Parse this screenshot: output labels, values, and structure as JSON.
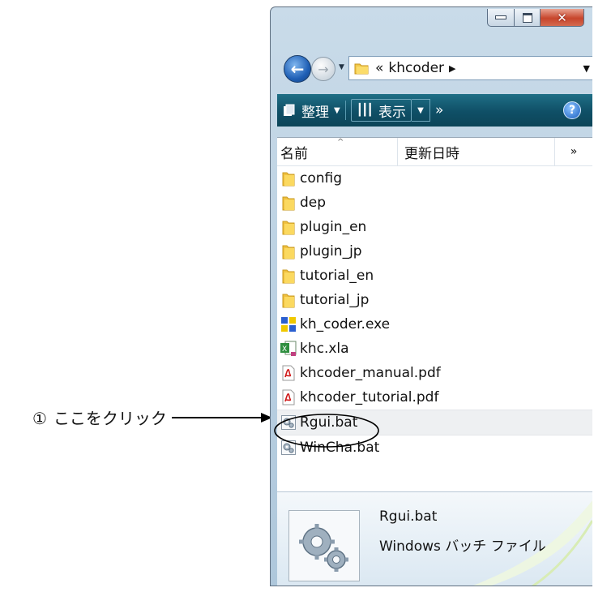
{
  "annotation": {
    "number": "①",
    "text": "ここをクリック"
  },
  "window": {
    "caption_buttons": {
      "minimize": "minimize-icon",
      "maximize": "maximize-icon",
      "close": "close-icon"
    },
    "address": {
      "prefix": "«",
      "path": "khcoder"
    },
    "toolbar": {
      "organize": "整理",
      "views": "表示",
      "more": "»",
      "help": "?"
    },
    "columns": {
      "name": "名前",
      "date_modified": "更新日時",
      "more": "»"
    },
    "files": [
      {
        "name": "config",
        "icon": "folder-icon"
      },
      {
        "name": "dep",
        "icon": "folder-icon"
      },
      {
        "name": "plugin_en",
        "icon": "folder-icon"
      },
      {
        "name": "plugin_jp",
        "icon": "folder-icon"
      },
      {
        "name": "tutorial_en",
        "icon": "folder-icon"
      },
      {
        "name": "tutorial_jp",
        "icon": "folder-icon"
      },
      {
        "name": "kh_coder.exe",
        "icon": "exe-icon"
      },
      {
        "name": "khc.xla",
        "icon": "excel-icon"
      },
      {
        "name": "khcoder_manual.pdf",
        "icon": "pdf-icon"
      },
      {
        "name": "khcoder_tutorial.pdf",
        "icon": "pdf-icon"
      },
      {
        "name": "Rgui.bat",
        "icon": "batch-gear-icon"
      },
      {
        "name": "WinCha.bat",
        "icon": "batch-gear-icon"
      }
    ],
    "details": {
      "name": "Rgui.bat",
      "type": "Windows バッチ ファイル"
    }
  }
}
